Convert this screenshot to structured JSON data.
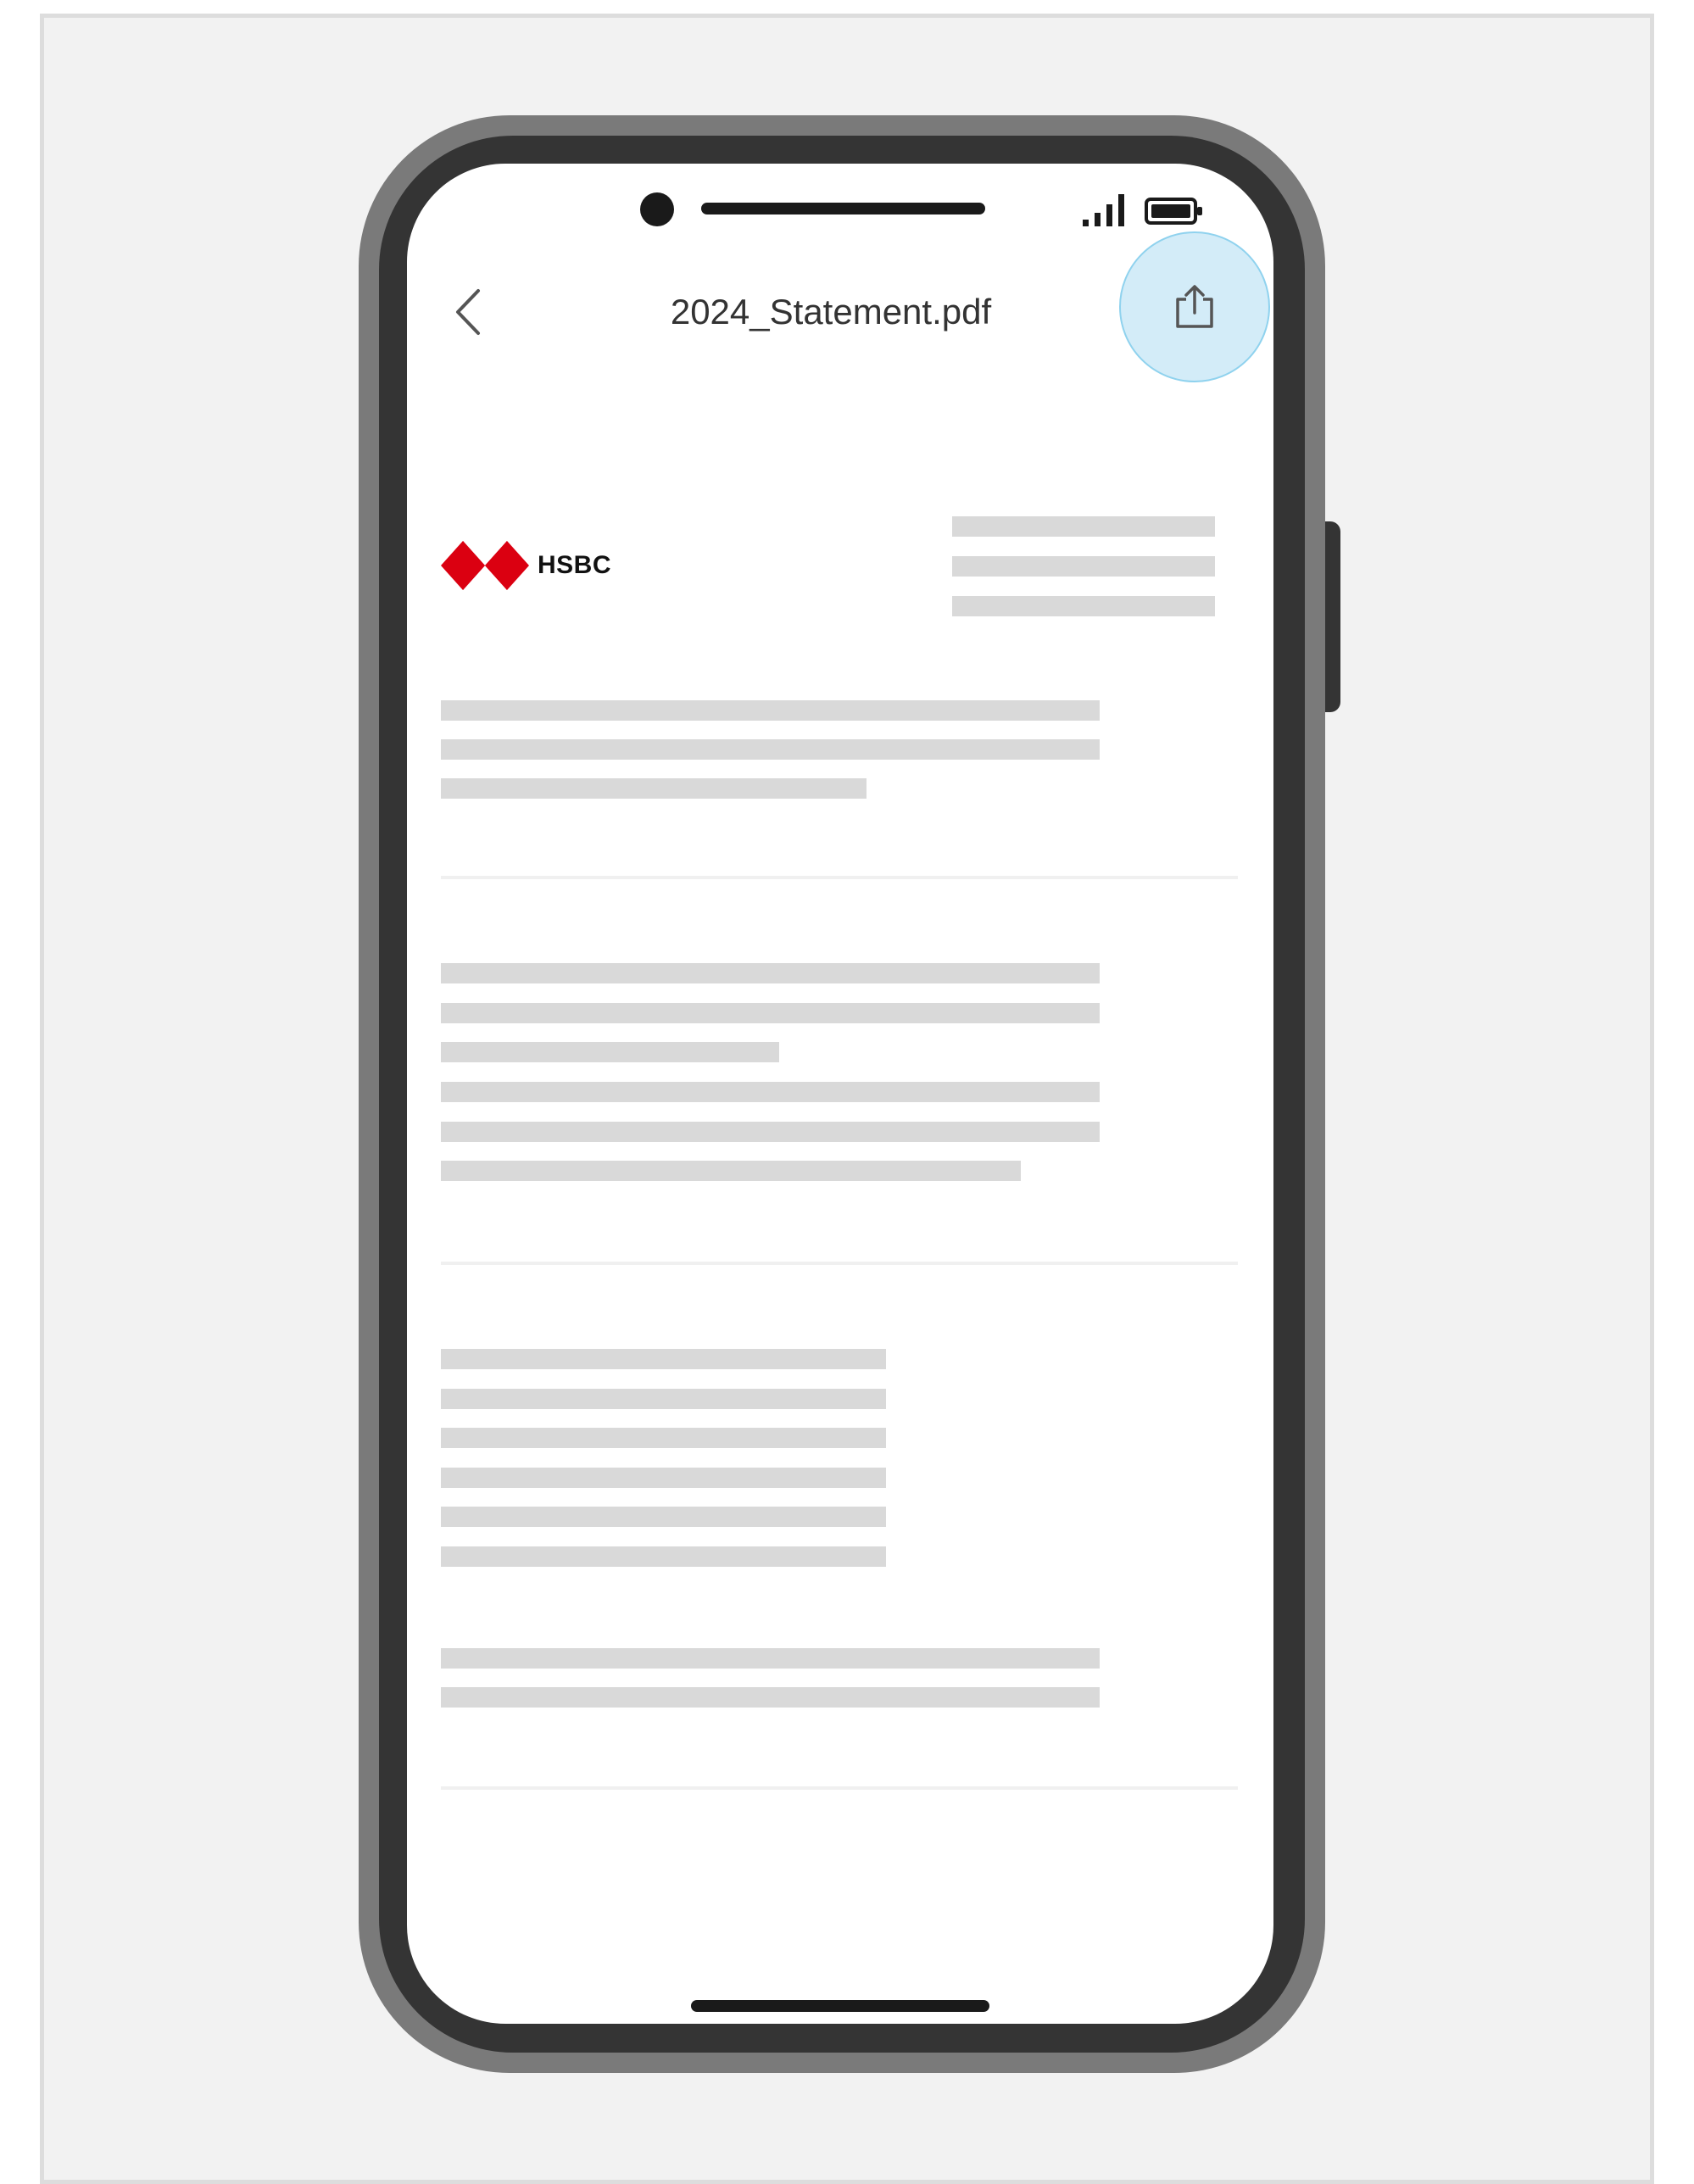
{
  "document": {
    "title": "2024_Statement.pdf"
  },
  "brand": {
    "name": "HSBC",
    "color": "#db0011"
  },
  "icons": {
    "back": "chevron-left-icon",
    "share": "share-icon",
    "signal": "signal-icon",
    "battery": "battery-icon"
  },
  "colors": {
    "highlight_fill": "#d3ecf8",
    "highlight_border": "#8fd2ee",
    "placeholder": "#d9d9d9"
  }
}
